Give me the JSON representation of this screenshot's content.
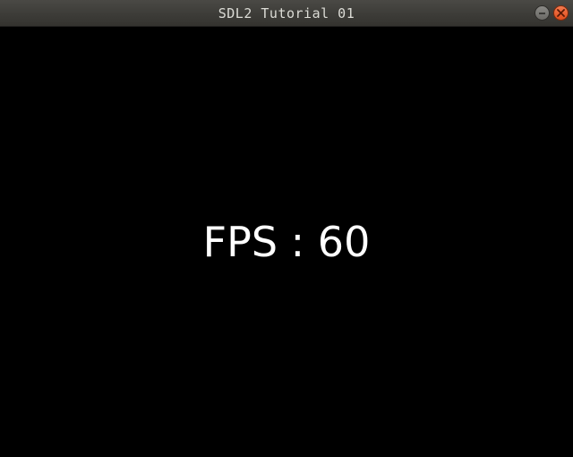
{
  "window": {
    "title": "SDL2 Tutorial 01"
  },
  "titlebar": {
    "minimize_icon": "minimize-icon",
    "close_icon": "close-icon",
    "colors": {
      "close_button": "#e8562a",
      "minimize_button": "#7b7a76",
      "titlebar_bg": "#3d3c38"
    }
  },
  "canvas": {
    "background": "#000000",
    "text_color": "#ffffff",
    "fps_label": "FPS : 60"
  }
}
